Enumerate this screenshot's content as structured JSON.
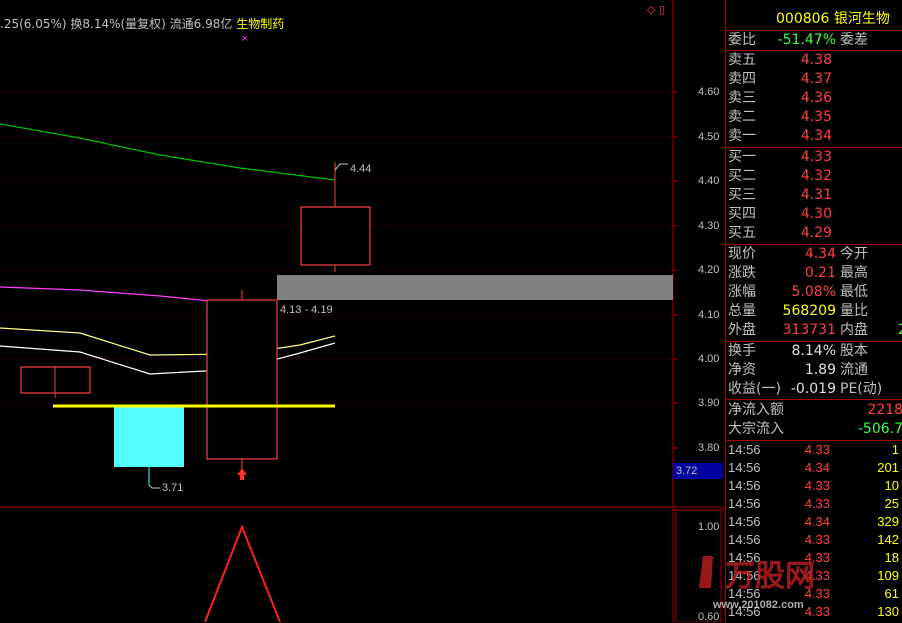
{
  "header": {
    "info_prefix": ".25(6.05%) 换8.14%(量复权) 流通6.98亿 ",
    "industry": "生物制药",
    "stock_code_name": "000806 银河生物",
    "corner_icons": "◇ ▯"
  },
  "axis": {
    "price_labels": [
      "4.60",
      "4.50",
      "4.40",
      "4.30",
      "4.20",
      "4.10",
      "4.00",
      "3.90",
      "3.80"
    ],
    "current_box": "3.72",
    "sub_labels": [
      "1.00",
      "0.60"
    ]
  },
  "annotations": {
    "high": "4.44",
    "low": "3.71",
    "range": "4.13 - 4.19"
  },
  "panel": {
    "weibi": {
      "label": "委比",
      "value": "-51.47%",
      "label2": "委差"
    },
    "asks": [
      {
        "label": "卖五",
        "value": "4.38"
      },
      {
        "label": "卖四",
        "value": "4.37"
      },
      {
        "label": "卖三",
        "value": "4.36"
      },
      {
        "label": "卖二",
        "value": "4.35"
      },
      {
        "label": "卖一",
        "value": "4.34"
      }
    ],
    "bids": [
      {
        "label": "买一",
        "value": "4.33"
      },
      {
        "label": "买二",
        "value": "4.32"
      },
      {
        "label": "买三",
        "value": "4.31"
      },
      {
        "label": "买四",
        "value": "4.30"
      },
      {
        "label": "买五",
        "value": "4.29"
      }
    ],
    "quote": [
      {
        "label": "现价",
        "value": "4.34",
        "label2": "今开",
        "color": "#ff4040"
      },
      {
        "label": "涨跌",
        "value": "0.21",
        "label2": "最高",
        "color": "#ff4040"
      },
      {
        "label": "涨幅",
        "value": "5.08%",
        "label2": "最低",
        "color": "#ff4040"
      },
      {
        "label": "总量",
        "value": "568209",
        "label2": "量比",
        "color": "#ffff00"
      },
      {
        "label": "外盘",
        "value": "313731",
        "label2": "内盘",
        "color": "#ff4040",
        "extra": "2"
      }
    ],
    "finance": [
      {
        "label": "换手",
        "value": "8.14%",
        "label2": "股本"
      },
      {
        "label": "净资",
        "value": "1.89",
        "label2": "流通"
      },
      {
        "label": "收益(一)",
        "value": "-0.019",
        "label2": "PE(动)"
      }
    ],
    "flow": [
      {
        "label": "净流入额",
        "value": "2218",
        "color": "#ff4040"
      },
      {
        "label": "大宗流入",
        "value": "-506.7",
        "color": "#40ff40"
      }
    ],
    "ticks": [
      {
        "time": "14:56",
        "price": "4.33",
        "vol": "1"
      },
      {
        "time": "14:56",
        "price": "4.34",
        "vol": "201"
      },
      {
        "time": "14:56",
        "price": "4.33",
        "vol": "10"
      },
      {
        "time": "14:56",
        "price": "4.33",
        "vol": "25"
      },
      {
        "time": "14:56",
        "price": "4.34",
        "vol": "329"
      },
      {
        "time": "14:56",
        "price": "4.33",
        "vol": "142"
      },
      {
        "time": "14:56",
        "price": "4.33",
        "vol": "18"
      },
      {
        "time": "14:56",
        "price": "4.33",
        "vol": "109"
      },
      {
        "time": "14:56",
        "price": "4.33",
        "vol": "61"
      },
      {
        "time": "14:56",
        "price": "4.33",
        "vol": "130"
      }
    ]
  },
  "watermark": {
    "brand": "万股网",
    "url": "www.201082.com"
  },
  "colors": {
    "up": "#ff4040",
    "down": "#54ffff",
    "ma1": "#00c000",
    "ma2": "#ff40ff",
    "ma3": "#ffff80",
    "ma4": "#ffffff",
    "band": "#808080"
  }
}
